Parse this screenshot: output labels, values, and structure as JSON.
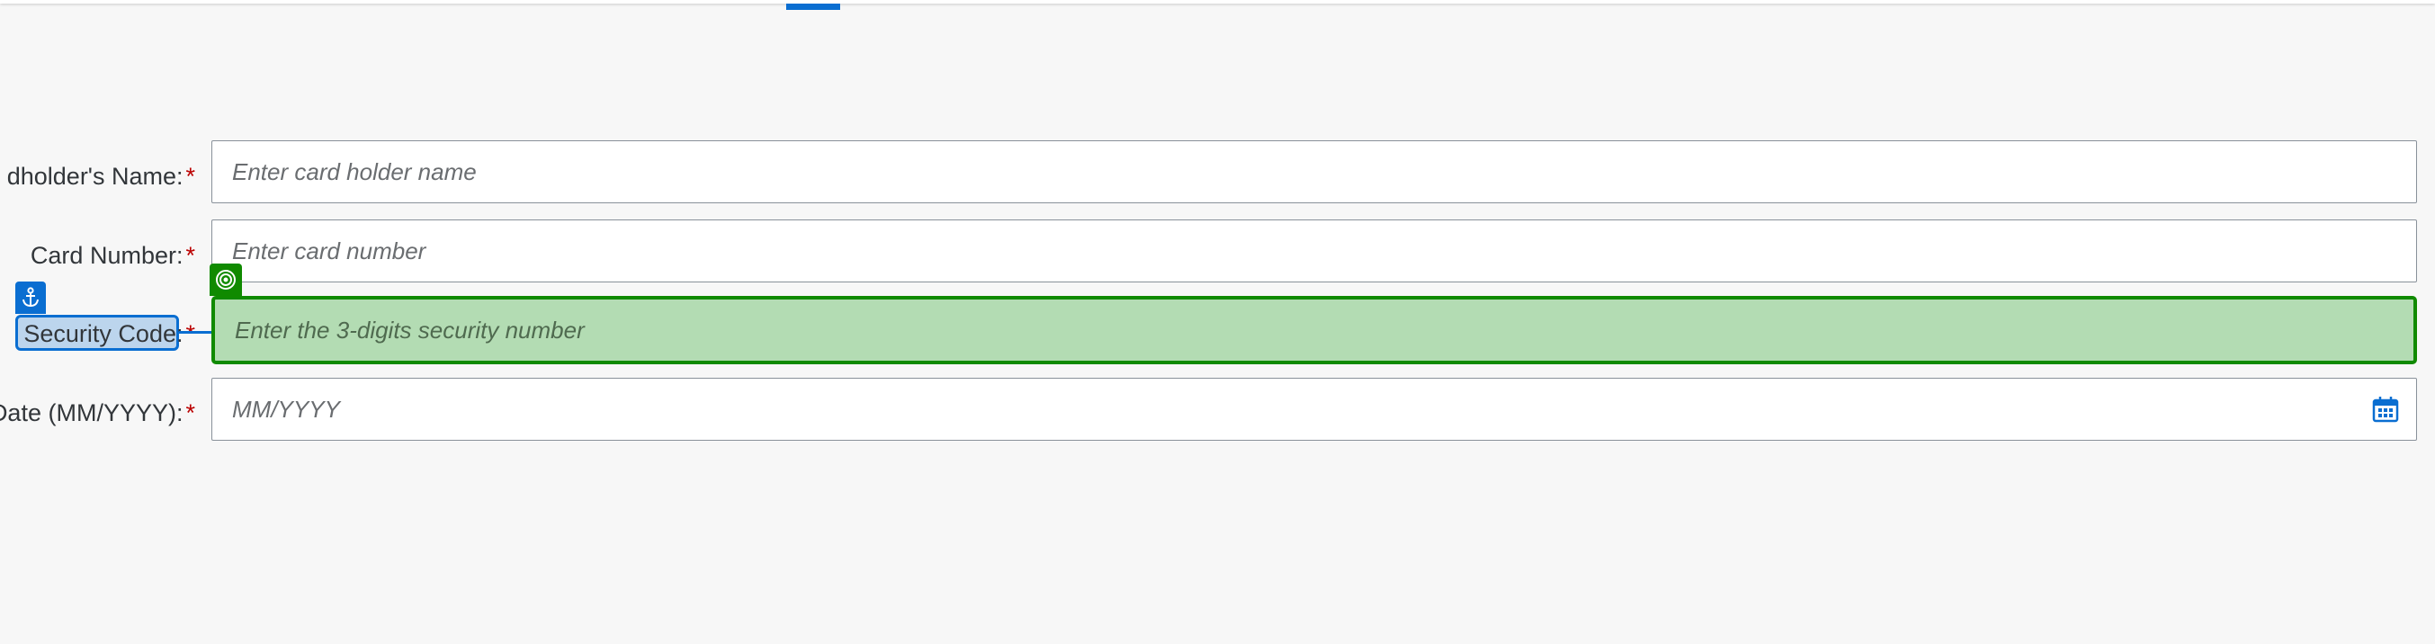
{
  "form": {
    "cardholder_name": {
      "label": "dholder's Name:",
      "required_mark": "*",
      "placeholder": "Enter card holder name",
      "value": ""
    },
    "card_number": {
      "label": "Card Number:",
      "required_mark": "*",
      "placeholder": "Enter card number",
      "value": ""
    },
    "security_code": {
      "label": "Security Code:",
      "required_mark": "*",
      "placeholder": "Enter the 3-digits security number",
      "value": ""
    },
    "expiry_date": {
      "label": "Date (MM/YYYY):",
      "required_mark": "*",
      "placeholder": "MM/YYYY",
      "value": "",
      "icon": "calendar-icon"
    }
  },
  "annotations": {
    "target_icon": "target-icon",
    "anchor_icon": "anchor-icon"
  },
  "colors": {
    "background": "#f7f7f7",
    "accent": "#0a6ed1",
    "required": "#bb0000",
    "highlight_fill": "#b3dcb3",
    "highlight_border": "#108a00"
  }
}
